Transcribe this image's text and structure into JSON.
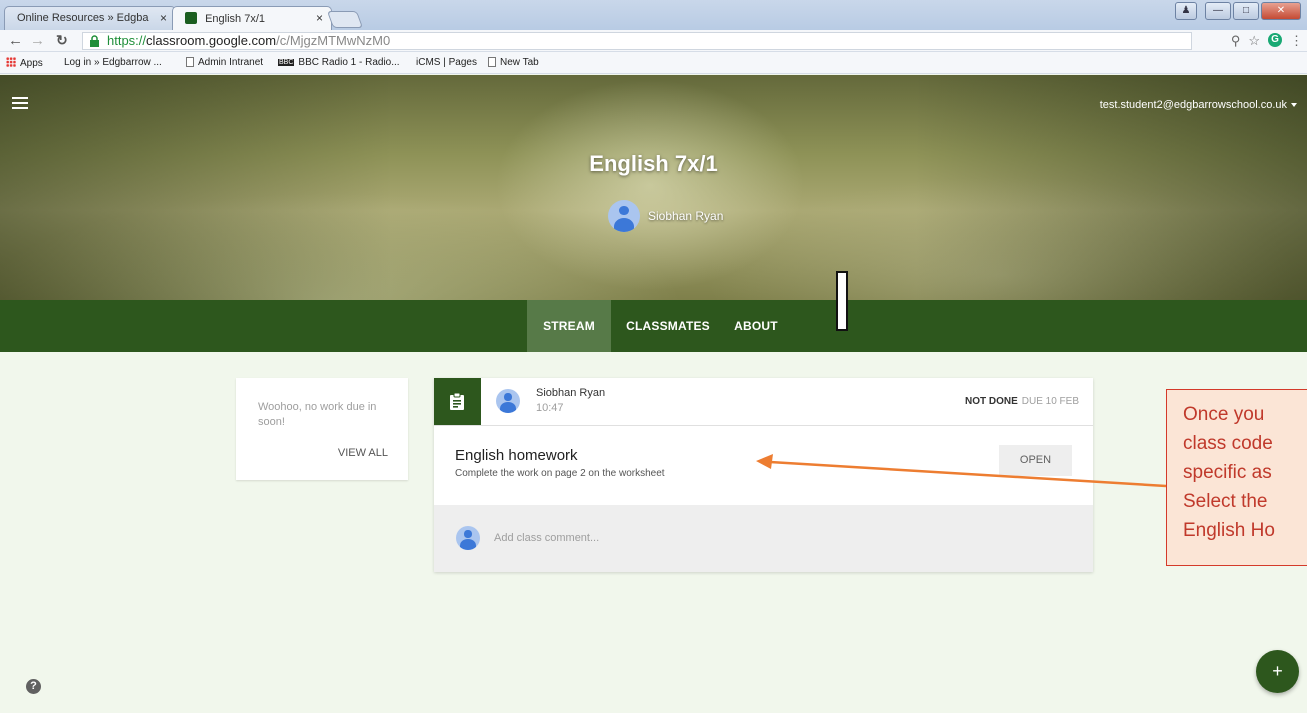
{
  "browser": {
    "tabs": [
      {
        "label": "Online Resources » Edgba",
        "active": false
      },
      {
        "label": "English 7x/1",
        "active": true
      }
    ],
    "close_glyph": "×",
    "url": {
      "scheme": "https://",
      "host": "classroom.google.com",
      "path": "/c/MjgzMTMwNzM0"
    },
    "bookmarks": [
      "Apps",
      "Log in » Edgbarrow ...",
      "Admin Intranet",
      "BBC Radio 1 - Radio...",
      "iCMS | Pages",
      "New Tab"
    ],
    "icons": [
      "back-icon",
      "forward-icon",
      "reload-icon",
      "lock-icon",
      "key-icon",
      "star-icon",
      "grammarly-icon",
      "menu-dots-icon"
    ]
  },
  "header": {
    "account": "test.student2@edgbarrowschool.co.uk",
    "class_name": "English 7x/1",
    "teacher": "Siobhan Ryan"
  },
  "tabs": [
    {
      "label": "STREAM",
      "active": true
    },
    {
      "label": "CLASSMATES",
      "active": false
    },
    {
      "label": "ABOUT",
      "active": false
    }
  ],
  "upcoming": {
    "message": "Woohoo, no work due in soon!",
    "view_all": "VIEW ALL"
  },
  "post": {
    "author": "Siobhan Ryan",
    "time": "10:47",
    "status": "NOT DONE",
    "due": "DUE 10 FEB",
    "title": "English homework",
    "description": "Complete the work on page 2 on the worksheet",
    "open_label": "OPEN",
    "comment_placeholder": "Add class comment..."
  },
  "callout": {
    "lines": [
      "Once you",
      "class code",
      "specific as",
      "Select the",
      "English Ho"
    ]
  },
  "help_label": "?",
  "fab_label": "+",
  "colors": {
    "classroom_green": "#2d571d",
    "active_tab": "#577a48",
    "page_bg": "#f1f7ec",
    "callout_border": "#d43a2a",
    "callout_fill": "#fbe5d6",
    "arrow": "#ed7d31"
  }
}
